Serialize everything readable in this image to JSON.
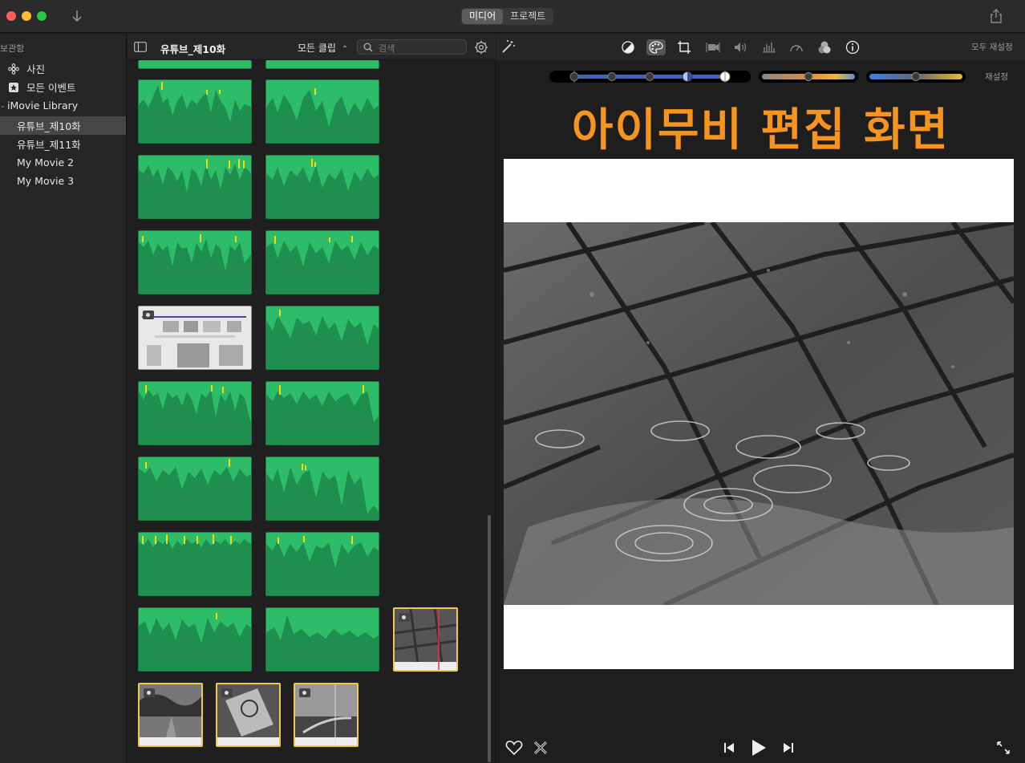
{
  "window": {
    "tabs": [
      {
        "label": "미디어",
        "active": true
      },
      {
        "label": "프로젝트",
        "active": false
      }
    ]
  },
  "sidebar": {
    "header": "보관함",
    "items": [
      {
        "label": "사진",
        "icon": "flower-icon"
      },
      {
        "label": "모든 이벤트",
        "icon": "star-icon"
      },
      {
        "label": "iMovie Library",
        "icon": "chevron-down-icon"
      },
      {
        "label": "유튜브_제10화",
        "selected": true
      },
      {
        "label": "유튜브_제11화"
      },
      {
        "label": "My Movie 2"
      },
      {
        "label": "My Movie 3"
      }
    ]
  },
  "browser": {
    "title": "유튜브_제10화",
    "filter_label": "모든 클립",
    "search_placeholder": "검색"
  },
  "viewer": {
    "reset_all_label": "모두 재설정",
    "reset_label": "재설정",
    "overlay_text": "아이무비 편집 화면",
    "tools": [
      "color-balance-icon",
      "color-correction-icon",
      "crop-icon",
      "stabilization-icon",
      "volume-icon",
      "noise-reduction-icon",
      "speed-icon",
      "clip-filter-icon",
      "info-icon"
    ]
  },
  "colors": {
    "accent_orange": "#f7941d",
    "clip_green": "#2dbd68",
    "selection_yellow": "#f2c94c"
  }
}
